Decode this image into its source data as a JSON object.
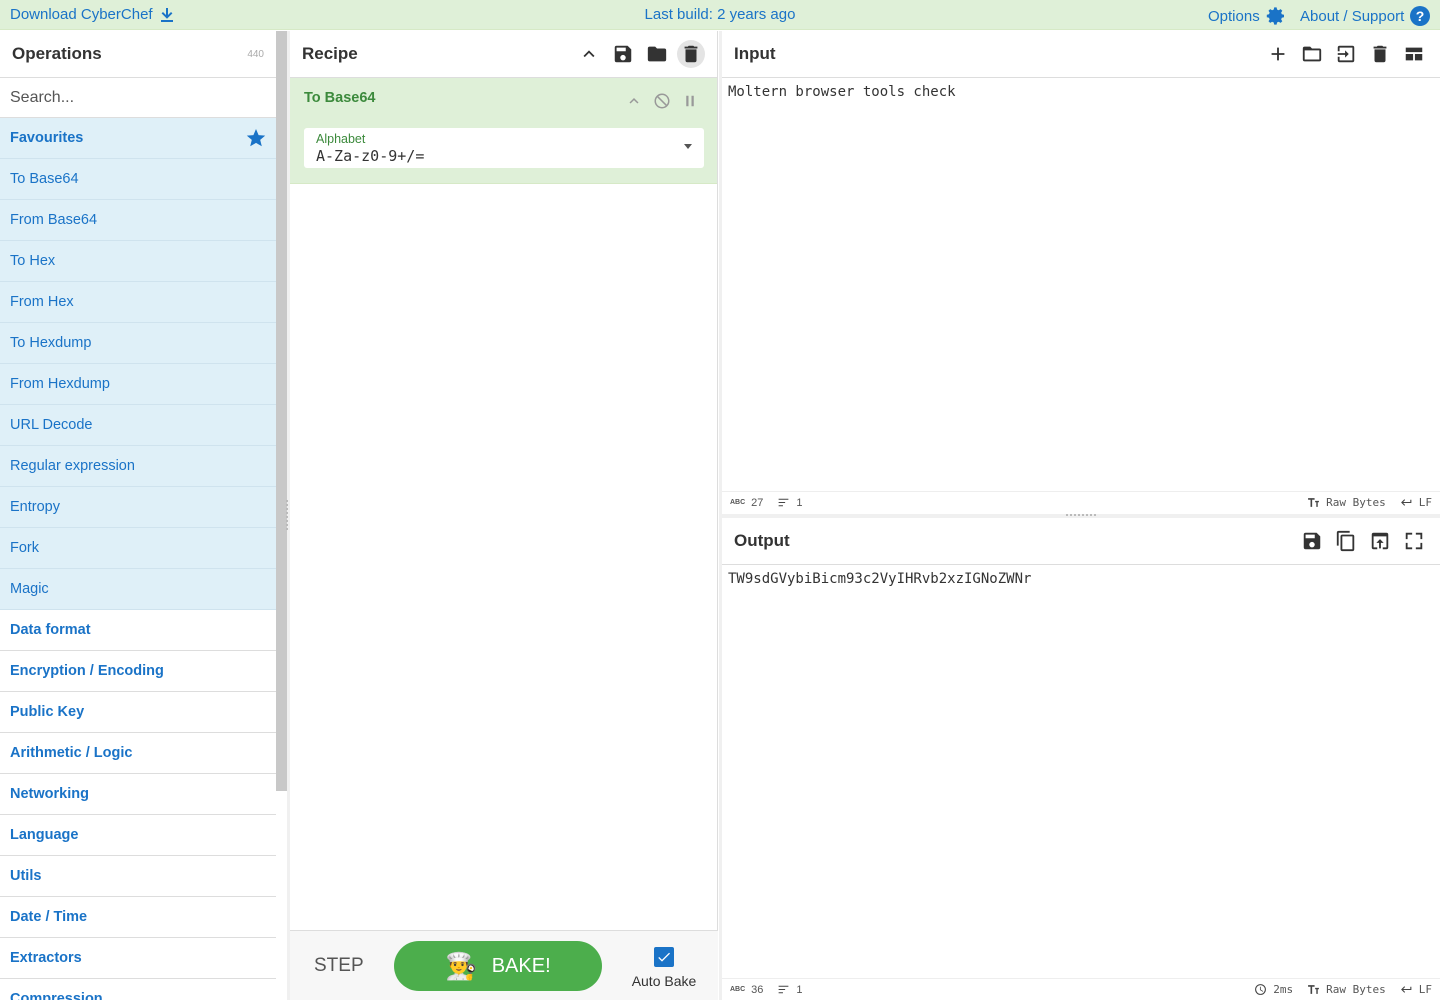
{
  "banner": {
    "download": "Download CyberChef",
    "last_build": "Last build: 2 years ago",
    "options": "Options",
    "about": "About / Support"
  },
  "operations": {
    "title": "Operations",
    "count": "440",
    "search_placeholder": "Search...",
    "favourites": "Favourites",
    "favourite_items": [
      "To Base64",
      "From Base64",
      "To Hex",
      "From Hex",
      "To Hexdump",
      "From Hexdump",
      "URL Decode",
      "Regular expression",
      "Entropy",
      "Fork",
      "Magic"
    ],
    "categories": [
      "Data format",
      "Encryption / Encoding",
      "Public Key",
      "Arithmetic / Logic",
      "Networking",
      "Language",
      "Utils",
      "Date / Time",
      "Extractors",
      "Compression"
    ]
  },
  "recipe": {
    "title": "Recipe",
    "operation": {
      "name": "To Base64",
      "arg_label": "Alphabet",
      "arg_value": "A-Za-z0-9+/="
    },
    "step": "STEP",
    "bake": "BAKE!",
    "auto_bake": "Auto Bake",
    "auto_bake_checked": true
  },
  "input": {
    "title": "Input",
    "text": "Moltern browser tools check",
    "length": "27",
    "lines": "1",
    "encoding": "Raw Bytes",
    "eol": "LF"
  },
  "output": {
    "title": "Output",
    "text": "TW9sdGVybiBicm93c2VyIHRvb2xzIGNoZWNr",
    "length": "36",
    "lines": "1",
    "time": "2ms",
    "encoding": "Raw Bytes",
    "eol": "LF"
  },
  "colors": {
    "accent": "#1a73c7",
    "banner_bg": "#dff0d8",
    "favourite_bg": "#dff0f8",
    "bake_green": "#4cae4c"
  }
}
